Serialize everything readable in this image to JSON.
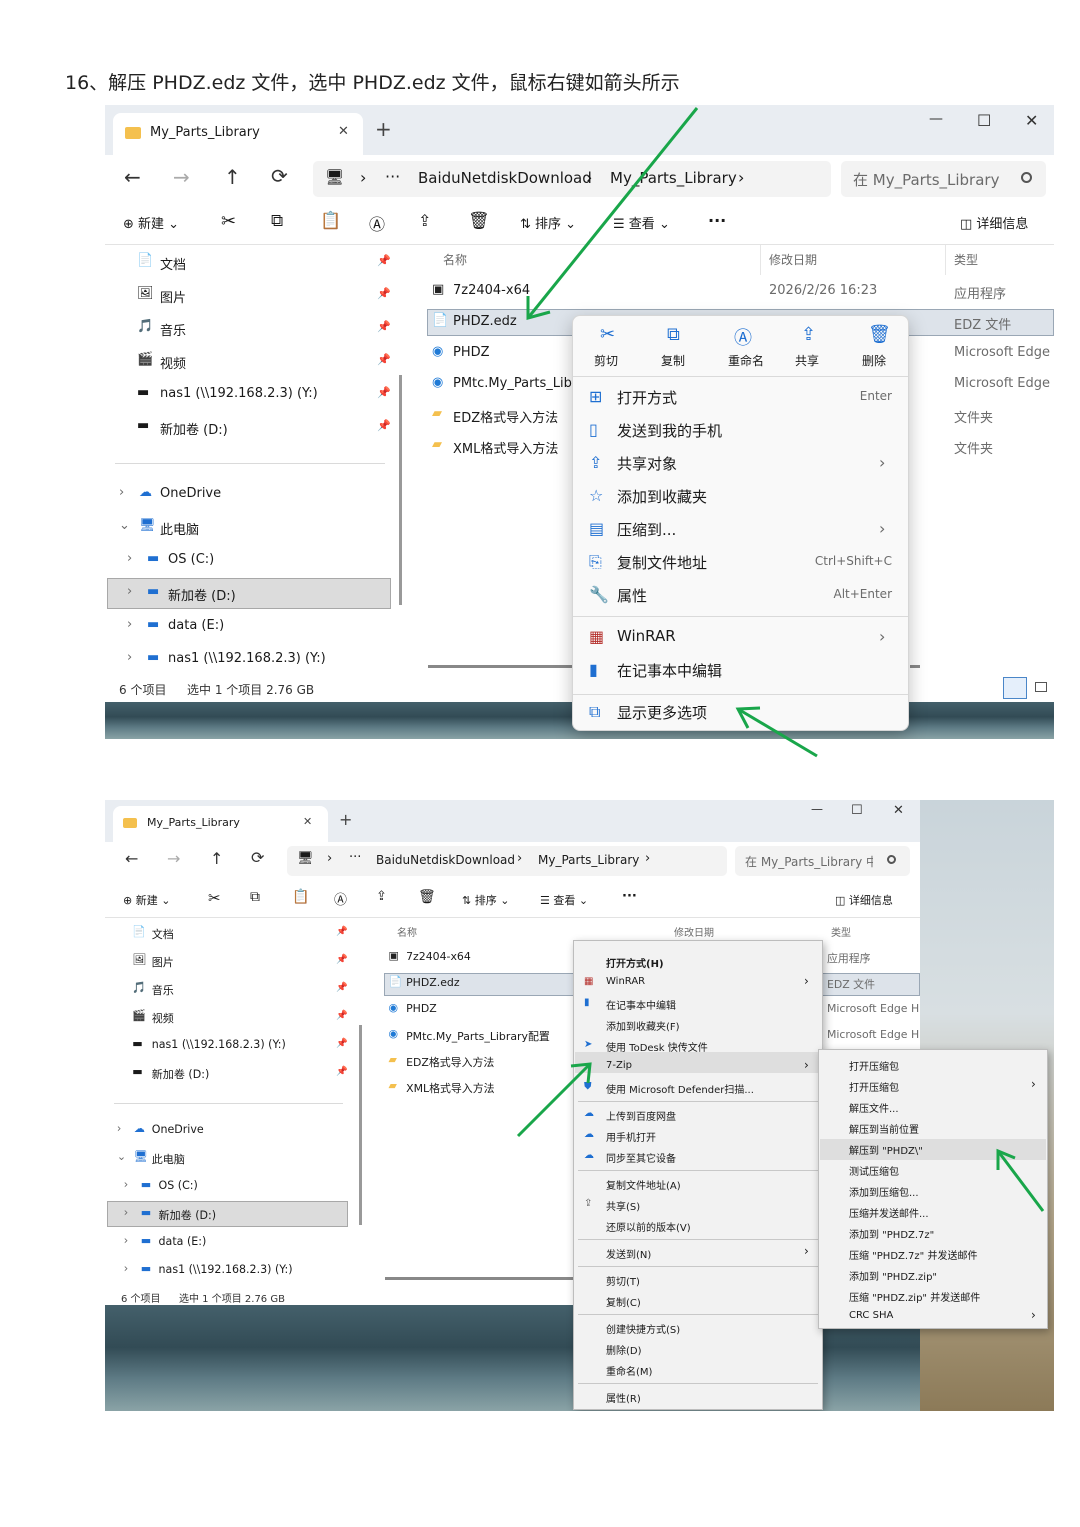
{
  "heading": "16、解压 PHDZ.edz 文件，选中 PHDZ.edz 文件，鼠标右键如箭头所示",
  "colors": {
    "accent_arrow": "#19a64a",
    "selection": "#dde3ea",
    "folder": "#f4c04e"
  },
  "win1": {
    "tab_title": "My_Parts_Library",
    "tab_close": "✕",
    "new_tab": "+",
    "win_min": "—",
    "win_max": "☐",
    "win_close": "✕",
    "nav": {
      "back": "←",
      "forward": "→",
      "up": "↑",
      "refresh": "⟳",
      "pc": "🖥",
      "sep": "›",
      "more": "···"
    },
    "breadcrumb": [
      "BaiduNetdiskDownload",
      "My_Parts_Library"
    ],
    "search_placeholder": "在 My_Parts_Library 中搜索",
    "toolbar": {
      "new": "新建",
      "sort": "排序",
      "view": "查看",
      "more": "···",
      "details": "详细信息"
    },
    "sidebar_quick": [
      "文档",
      "图片",
      "音乐",
      "视频",
      "nas1 (\\\\192.168.2.3) (Y:)",
      "新加卷 (D:)"
    ],
    "sidebar_tree": [
      "OneDrive",
      "此电脑",
      "OS (C:)",
      "新加卷 (D:)",
      "data (E:)",
      "nas1 (\\\\192.168.2.3) (Y:)"
    ],
    "columns": {
      "name": "名称",
      "date": "修改日期",
      "type": "类型"
    },
    "files": [
      {
        "name": "7z2404-x64",
        "date": "2026/2/26 16:23",
        "type": "应用程序"
      },
      {
        "name": "PHDZ.edz",
        "date": "",
        "type": "EDZ 文件"
      },
      {
        "name": "PHDZ",
        "date": "",
        "type": "Microsoft Edge H"
      },
      {
        "name": "PMtc.My_Parts_Library",
        "date": "",
        "type": "Microsoft Edge H"
      },
      {
        "name": "EDZ格式导入方法",
        "date": "",
        "type": "文件夹"
      },
      {
        "name": "XML格式导入方法",
        "date": "",
        "type": "文件夹"
      }
    ],
    "status": {
      "count": "6 个项目",
      "selected": "选中 1 个项目  2.76 GB"
    },
    "ctx_top": [
      "剪切",
      "复制",
      "重命名",
      "共享",
      "删除"
    ],
    "ctx_items": [
      {
        "label": "打开方式",
        "key": "Enter",
        "icon": "open-icon"
      },
      {
        "label": "发送到我的手机",
        "key": "",
        "icon": "phone-icon"
      },
      {
        "label": "共享对象",
        "key": "›",
        "icon": "share-icon"
      },
      {
        "label": "添加到收藏夹",
        "key": "",
        "icon": "star-icon"
      },
      {
        "label": "压缩到...",
        "key": "›",
        "icon": "zip-icon"
      },
      {
        "label": "复制文件地址",
        "key": "Ctrl+Shift+C",
        "icon": "path-icon"
      },
      {
        "label": "属性",
        "key": "Alt+Enter",
        "icon": "wrench-icon"
      },
      {
        "label": "WinRAR",
        "key": "›",
        "icon": "winrar-icon"
      },
      {
        "label": "在记事本中编辑",
        "key": "",
        "icon": "notepad-icon"
      },
      {
        "label": "显示更多选项",
        "key": "",
        "icon": "more-options-icon"
      }
    ]
  },
  "win2": {
    "tab_title": "My_Parts_Library",
    "tab_close": "✕",
    "new_tab": "+",
    "win_min": "—",
    "win_max": "☐",
    "win_close": "✕",
    "nav": {
      "back": "←",
      "forward": "→",
      "up": "↑",
      "refresh": "⟳",
      "pc": "🖥",
      "sep": "›",
      "more": "···"
    },
    "breadcrumb": [
      "BaiduNetdiskDownload",
      "My_Parts_Library"
    ],
    "search_placeholder": "在 My_Parts_Library 中搜索",
    "toolbar": {
      "new": "新建",
      "sort": "排序",
      "view": "查看",
      "more": "···",
      "details": "详细信息"
    },
    "sidebar_quick": [
      "文档",
      "图片",
      "音乐",
      "视频",
      "nas1 (\\\\192.168.2.3) (Y:)",
      "新加卷 (D:)"
    ],
    "sidebar_tree": [
      "OneDrive",
      "此电脑",
      "OS (C:)",
      "新加卷 (D:)",
      "data (E:)",
      "nas1 (\\\\192.168.2.3) (Y:)"
    ],
    "columns": {
      "name": "名称",
      "date": "修改日期",
      "type": "类型"
    },
    "files": [
      {
        "name": "7z2404-x64",
        "type": "应用程序"
      },
      {
        "name": "PHDZ.edz",
        "type": "EDZ 文件"
      },
      {
        "name": "PHDZ",
        "type": "Microsoft Edge H"
      },
      {
        "name": "PMtc.My_Parts_Library配置",
        "type": "Microsoft Edge H"
      },
      {
        "name": "EDZ格式导入方法",
        "type": ""
      },
      {
        "name": "XML格式导入方法",
        "type": ""
      }
    ],
    "status": {
      "count": "6 个项目",
      "selected": "选中 1 个项目  2.76 GB"
    },
    "classic_menu": [
      "打开方式(H)",
      "WinRAR",
      "在记事本中编辑",
      "添加到收藏夹(F)",
      "使用 ToDesk 快传文件",
      "7-Zip",
      "使用 Microsoft Defender扫描...",
      "上传到百度网盘",
      "用手机打开",
      "同步至其它设备",
      "复制文件地址(A)",
      "共享(S)",
      "还原以前的版本(V)",
      "发送到(N)",
      "剪切(T)",
      "复制(C)",
      "创建快捷方式(S)",
      "删除(D)",
      "重命名(M)",
      "属性(R)"
    ],
    "submenu_arrow": "›",
    "sevenzip_menu": [
      "打开压缩包",
      "打开压缩包",
      "解压文件...",
      "解压到当前位置",
      "解压到 \"PHDZ\\\"",
      "测试压缩包",
      "添加到压缩包...",
      "压缩并发送邮件...",
      "添加到 \"PHDZ.7z\"",
      "压缩 \"PHDZ.7z\" 并发送邮件",
      "添加到 \"PHDZ.zip\"",
      "压缩 \"PHDZ.zip\" 并发送邮件",
      "CRC SHA"
    ]
  }
}
